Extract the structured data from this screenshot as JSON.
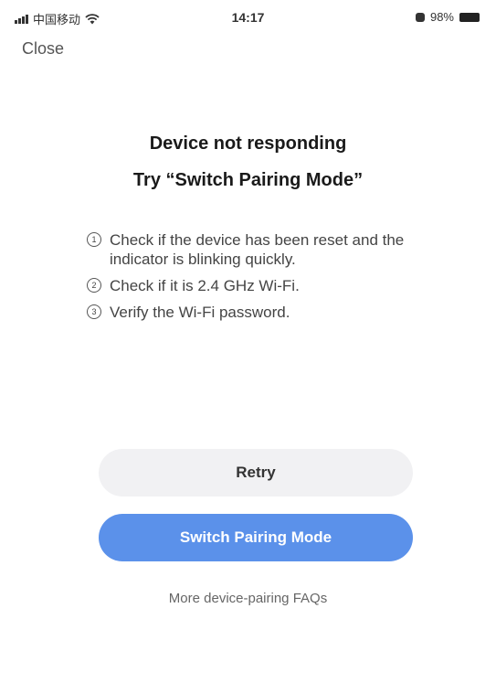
{
  "status_bar": {
    "carrier": "中国移动",
    "time": "14:17",
    "battery": "98%"
  },
  "nav": {
    "close_label": "Close"
  },
  "main": {
    "title": "Device not responding",
    "subtitle": "Try “Switch Pairing Mode”",
    "tips": [
      {
        "number": "1",
        "text": "Check if the device has been reset and the indicator is blinking quickly."
      },
      {
        "number": "2",
        "text": "Check if it is 2.4 GHz Wi-Fi."
      },
      {
        "number": "3",
        "text": "Verify the Wi-Fi password."
      }
    ]
  },
  "actions": {
    "retry_label": "Retry",
    "switch_label": "Switch Pairing Mode",
    "faq_label": "More device-pairing FAQs"
  },
  "colors": {
    "primary": "#5b91ea",
    "secondary_button": "#f1f1f3"
  },
  "icons": {
    "signal": "signal-icon",
    "wifi": "wifi-icon",
    "lock": "rotation-lock-icon",
    "battery": "battery-icon"
  }
}
